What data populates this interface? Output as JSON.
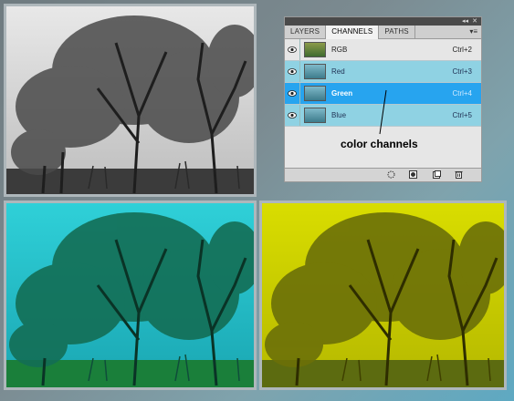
{
  "panel": {
    "tabs": [
      {
        "label": "LAYERS"
      },
      {
        "label": "CHANNELS"
      },
      {
        "label": "PATHS"
      }
    ],
    "channels": [
      {
        "name": "RGB",
        "shortcut": "Ctrl+2"
      },
      {
        "name": "Red",
        "shortcut": "Ctrl+3"
      },
      {
        "name": "Green",
        "shortcut": "Ctrl+4"
      },
      {
        "name": "Blue",
        "shortcut": "Ctrl+5"
      }
    ],
    "annotation": "color channels",
    "bottom_icons": [
      "load-selection-icon",
      "save-selection-icon",
      "new-channel-icon",
      "delete-channel-icon"
    ]
  },
  "images": [
    {
      "name": "grayscale-tree-photo",
      "tint": "#808080"
    },
    {
      "name": "cyan-tree-photo",
      "tint": "#1bbcc4"
    },
    {
      "name": "yellow-tree-photo",
      "tint": "#d2d400"
    }
  ],
  "colors": {
    "selected_row": "#27a4ef",
    "channel_row": "#8fd2e3",
    "panel_bg": "#e6e6e6"
  }
}
